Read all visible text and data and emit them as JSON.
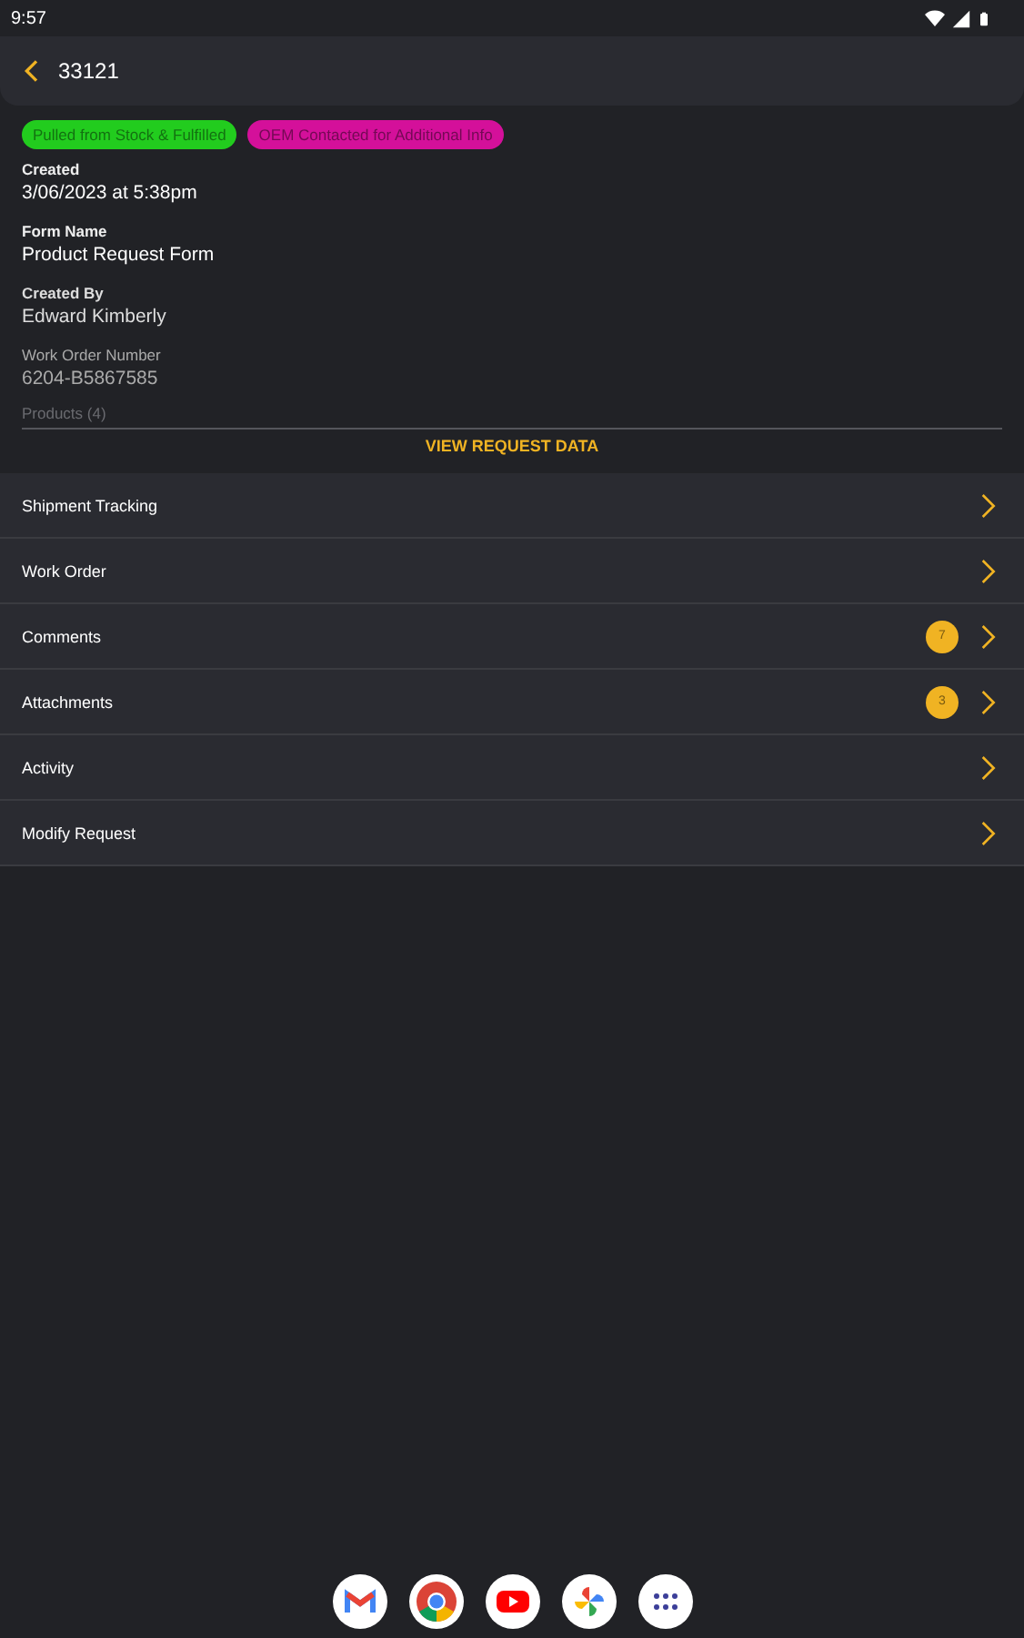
{
  "status_bar": {
    "time": "9:57"
  },
  "header": {
    "title": "33121"
  },
  "tags": [
    {
      "label": "Pulled from Stock & Fulfilled",
      "color": "#22cc1e"
    },
    {
      "label": "OEM Contacted for Additional Info",
      "color": "#d4109a"
    }
  ],
  "fields": [
    {
      "label": "Created",
      "value": "3/06/2023 at 5:38pm"
    },
    {
      "label": "Form Name",
      "value": "Product Request Form"
    },
    {
      "label": "Created By",
      "value": "Edward Kimberly"
    },
    {
      "label": "Work Order Number",
      "value": "6204-B5867585"
    }
  ],
  "products_label": "Products (4)",
  "view_button": "VIEW REQUEST DATA",
  "menu": [
    {
      "label": "Shipment Tracking"
    },
    {
      "label": "Work Order"
    },
    {
      "label": "Comments",
      "count": "7"
    },
    {
      "label": "Attachments",
      "count": "3"
    },
    {
      "label": "Activity"
    },
    {
      "label": "Modify Request"
    }
  ],
  "dock": [
    {
      "kind": "mail"
    },
    {
      "kind": "globe"
    },
    {
      "kind": "play"
    },
    {
      "kind": "pinwheel"
    },
    {
      "kind": "apps"
    }
  ]
}
